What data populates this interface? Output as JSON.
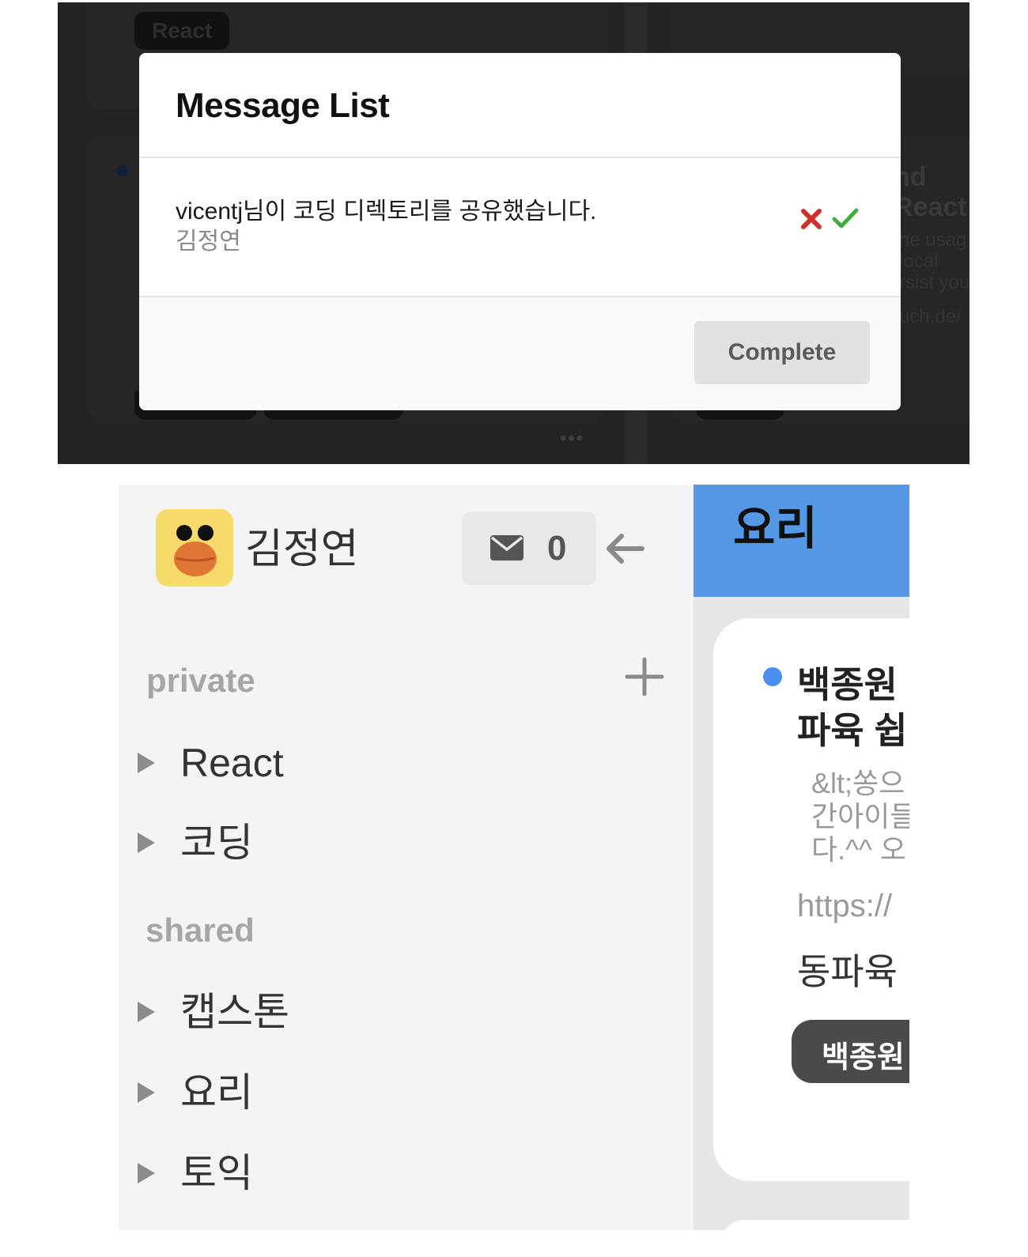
{
  "background_app": {
    "tag_top": "React",
    "card_title_lines": [
      "nd",
      "React ·"
    ],
    "card_desc_lines": [
      "he usag",
      "local",
      "rsist you"
    ],
    "card_url": "uch.de/",
    "more_dots": "•••"
  },
  "modal": {
    "title": "Message List",
    "messages": [
      {
        "text": "vicentj님이 코딩 디렉토리를 공유했습니다.",
        "sender": "김정연"
      }
    ],
    "complete_label": "Complete"
  },
  "sidebar": {
    "user_name": "김정연",
    "mail_count": "0",
    "private_label": "private",
    "shared_label": "shared",
    "private_folders": [
      "React",
      "코딩"
    ],
    "shared_folders": [
      "캡스톤",
      "요리",
      "토익"
    ]
  },
  "content": {
    "category_title": "요리",
    "card": {
      "title": "백종원\n파육 쉽",
      "desc": "&lt;쏭으\n간아이들\n다.^^ 오",
      "url": "https://",
      "subtitle": "동파육",
      "tag": "백종원"
    }
  },
  "colors": {
    "modal_overlay": "#1f1f21",
    "category_bar": "#5599e6",
    "reject_icon": "#d0302e",
    "accept_icon": "#3fae3f",
    "card_dot": "#4a8ef0"
  }
}
